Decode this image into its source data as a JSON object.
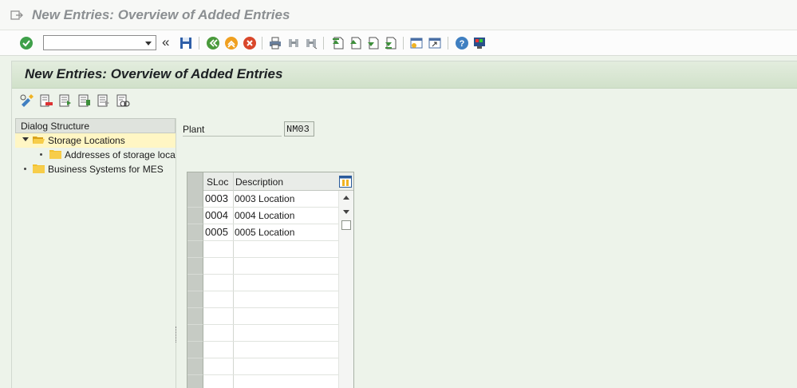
{
  "window": {
    "title": "New Entries: Overview of Added Entries"
  },
  "toolbar": {
    "command_field_value": "",
    "back_glyph": "«",
    "icons": [
      "enter-icon",
      "save-icon",
      "back-icon",
      "exit-icon",
      "cancel-icon",
      "print-icon",
      "find-icon",
      "find-next-icon",
      "first-page-icon",
      "previous-page-icon",
      "next-page-icon",
      "last-page-icon",
      "create-session-icon",
      "shortcut-icon",
      "help-icon",
      "customize-layout-icon"
    ]
  },
  "page": {
    "title": "New Entries: Overview of Added Entries"
  },
  "app_toolbar": {
    "icons": [
      "change-display-icon",
      "delete-icon",
      "select-all-icon",
      "select-block-icon",
      "deselect-all-icon",
      "other-entry-icon"
    ]
  },
  "dialog_structure": {
    "header": "Dialog Structure",
    "items": [
      {
        "label": "Storage Locations",
        "level": 0,
        "expanded": true,
        "selected": true
      },
      {
        "label": "Addresses of storage loca",
        "level": 1,
        "expanded": false,
        "selected": false
      },
      {
        "label": "Business Systems for MES",
        "level": 0,
        "expanded": false,
        "selected": false
      }
    ]
  },
  "plant": {
    "label": "Plant",
    "value": "NM03"
  },
  "table": {
    "columns": [
      "SLoc",
      "Description"
    ],
    "rows": [
      {
        "sloc": "0003",
        "description": "0003 Location"
      },
      {
        "sloc": "0004",
        "description": "0004 Location"
      },
      {
        "sloc": "0005",
        "description": "0005 Location"
      },
      {
        "sloc": "",
        "description": ""
      },
      {
        "sloc": "",
        "description": ""
      },
      {
        "sloc": "",
        "description": ""
      },
      {
        "sloc": "",
        "description": ""
      },
      {
        "sloc": "",
        "description": ""
      },
      {
        "sloc": "",
        "description": ""
      },
      {
        "sloc": "",
        "description": ""
      },
      {
        "sloc": "",
        "description": ""
      },
      {
        "sloc": "",
        "description": ""
      }
    ]
  },
  "colors": {
    "title_gray": "#8b8f92",
    "panel_green": "#edf3ea",
    "header_green": "#d1e1ca",
    "selected_tree_item": "#fff6c4",
    "folder_yellow": "#f2c12e"
  }
}
